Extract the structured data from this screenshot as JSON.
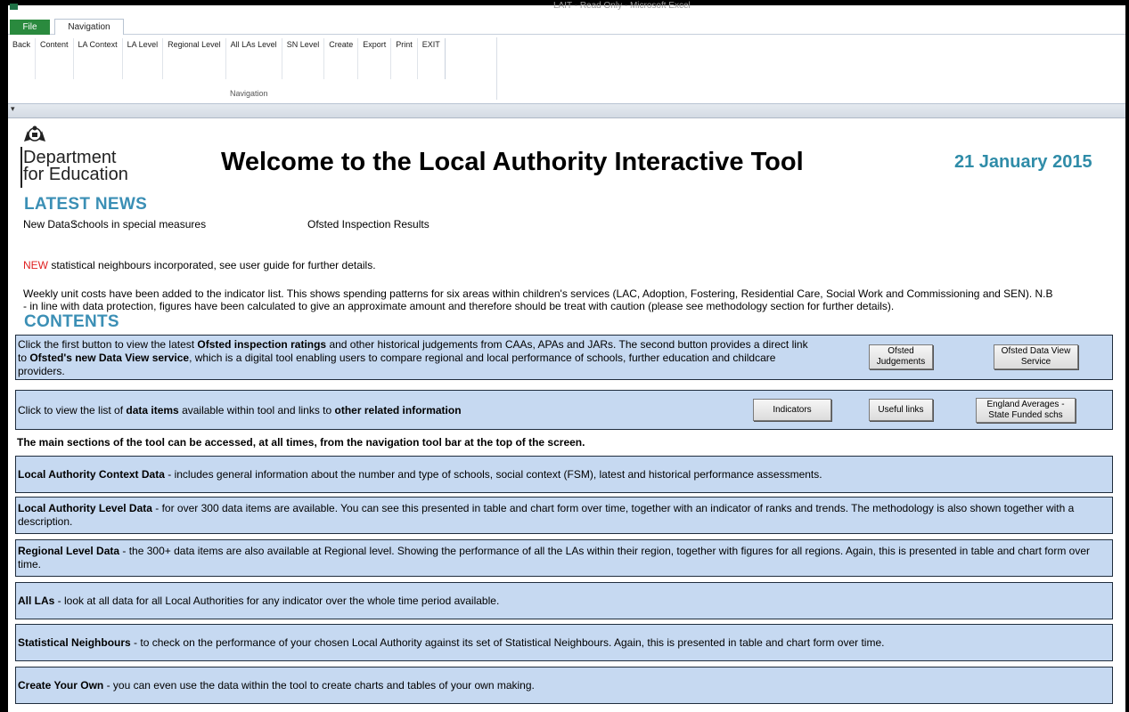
{
  "window": {
    "title": "LAIT - Read Only - Microsoft Excel"
  },
  "ribbon": {
    "tabs": {
      "file": "File",
      "navigation": "Navigation"
    },
    "buttons": [
      "Back",
      "Content",
      "LA Context",
      "LA Level",
      "Regional Level",
      "All LAs Level",
      "SN Level",
      "Create",
      "Export",
      "Print",
      "EXIT"
    ],
    "group_label": "Navigation"
  },
  "header": {
    "logo_line1": "Department",
    "logo_line2": "for Education",
    "title": "Welcome to the Local Authority Interactive Tool",
    "date": "21 January 2015"
  },
  "news": {
    "heading": "LATEST NEWS",
    "new_data_label": "New Data :",
    "item1": "Schools in special measures",
    "item2": "Ofsted Inspection Results",
    "new_tag": "NEW",
    "sn_text": " statistical neighbours incorporated, see user guide for further details.",
    "unit_costs_1": "Weekly unit costs have been added to the indicator list.  This shows spending patterns for six areas within children's services (LAC, Adoption, Fostering, Residential Care, Social Work and Commissioning and SEN).  N.B",
    "unit_costs_2": "- in line with data protection, figures have been calculated to give an approximate amount and therefore should be treat with caution (please see methodology section for further details)."
  },
  "contents": {
    "heading": "CONTENTS",
    "ofsted_panel": {
      "t1": "Click the first button to view the latest ",
      "b1": "Ofsted inspection ratings",
      "t2": " and other historical judgements from CAAs, APAs and JARs.  The second button provides a direct link",
      "t3": "to ",
      "b2": "Ofsted's new Data View service",
      "t4": ", which is a digital tool enabling users to compare regional and local performance of schools, further education and childcare",
      "t5": "providers.",
      "btn_judgements": "Ofsted Judgements",
      "btn_dataview": "Ofsted Data View Service"
    },
    "items_panel": {
      "t1": "Click to view the list of ",
      "b1": "data items",
      "t2": " available within tool and links to ",
      "b2": "other related information",
      "btn_indicators": "Indicators",
      "btn_links": "Useful links",
      "btn_england": "England Averages - State Funded schs"
    },
    "main_sections_note": "The main sections of the tool can be accessed, at all times, from the navigation tool bar at the top of the screen.",
    "sections": [
      {
        "title": "Local Authority Context Data",
        "text": " - includes general information about the number and type of schools, social context (FSM), latest and historical performance assessments."
      },
      {
        "title": "Local Authority Level Data",
        "text": " - for over 300 data items are available. You can see this presented in table and chart form over time, together with an indicator of ranks and trends. The methodology is also shown together with a description."
      },
      {
        "title": "Regional Level Data",
        "text": " - the 300+ data items are also available at Regional level. Showing the performance of all the LAs within their region, together with figures for all regions. Again, this is presented in table and chart form over time."
      },
      {
        "title": "All LAs",
        "text": " - look at all data for all Local Authorities for any indicator over the whole time period available."
      },
      {
        "title": "Statistical Neighbours",
        "text": " - to check on the performance of your chosen Local Authority against its set of Statistical Neighbours. Again, this is presented in table and chart form over time."
      },
      {
        "title": "Create Your Own",
        "text": " - you can even use the data within the tool to create charts and tables of your own making."
      }
    ]
  }
}
